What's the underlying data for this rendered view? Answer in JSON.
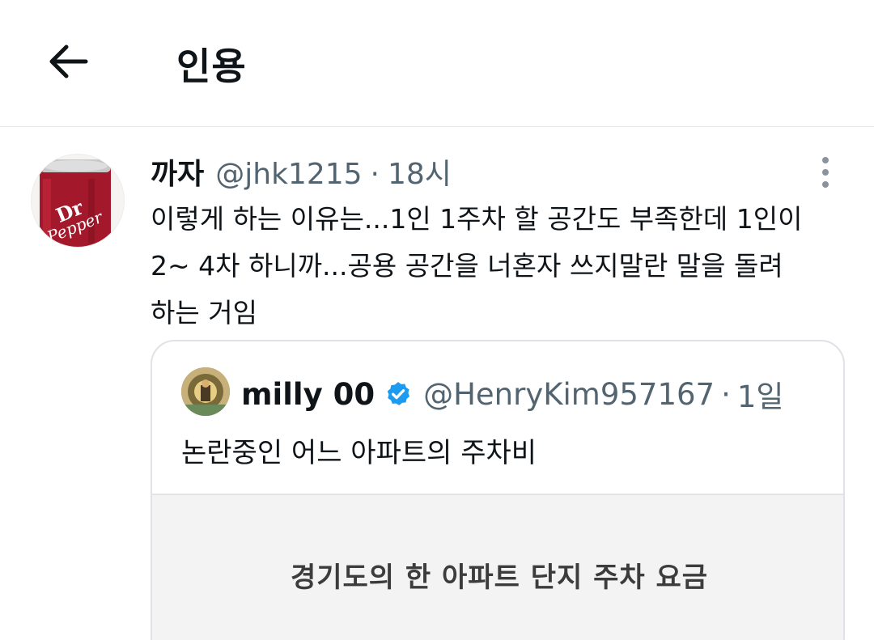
{
  "header": {
    "title": "인용",
    "back_icon": "arrow-left-icon"
  },
  "tweet": {
    "display_name": "까자",
    "handle": "@jhk1215",
    "separator": "·",
    "time": "18시",
    "text": "이렇게 하는 이유는...1인 1주차 할 공간도 부족한데 1인이\n2~ 4차 하니까...공용 공간을 너혼자 쓰지말란 말을 돌려\n하는 거임",
    "avatar_icon": "dr-pepper-can-icon",
    "avatar_logo_text": "Dr Pepper",
    "more_icon": "more-vertical-icon"
  },
  "quoted": {
    "display_name": "milly 00",
    "handle": "@HenryKim957167",
    "separator": "·",
    "time": "1일",
    "verified_icon": "verified-badge-icon",
    "text": "논란중인 어느 아파트의 주차비",
    "media_caption": "경기도의 한 아파트 단지 주차 요금"
  },
  "colors": {
    "text_primary": "#0f1419",
    "text_secondary": "#536471",
    "verified_blue": "#1d9bf0",
    "divider": "#e6e6e6",
    "can_red": "#a3182a"
  }
}
